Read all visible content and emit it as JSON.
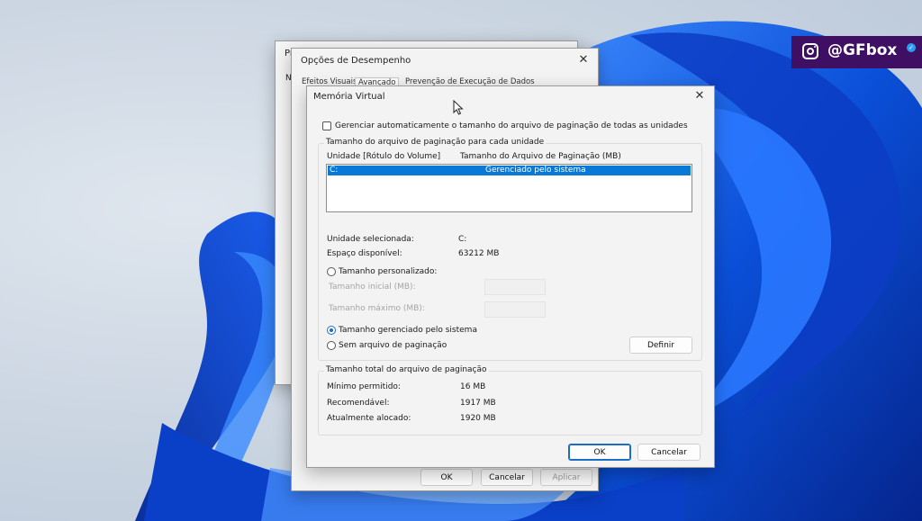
{
  "watermark": {
    "handle": "@GFbox",
    "icon": "instagram-icon",
    "verified_icon": "verified-check-icon"
  },
  "back_window": {
    "title": "Pr",
    "tab_letter": "N"
  },
  "perf_window": {
    "title": "Opções de Desempenho",
    "tabs": [
      "Efeitos Visuais",
      "Avançado",
      "Prevenção de Execução de Dados"
    ],
    "buttons": {
      "ok": "OK",
      "cancel": "Cancelar",
      "apply": "Aplicar"
    }
  },
  "vm_dialog": {
    "title": "Memória Virtual",
    "auto_manage_label": "Gerenciar automaticamente o tamanho do arquivo de paginação de todas as unidades",
    "auto_manage_checked": false,
    "per_drive_group": {
      "label": "Tamanho do arquivo de paginação para cada unidade",
      "col_drive": "Unidade [Rótulo do Volume]",
      "col_size": "Tamanho do Arquivo de Paginação (MB)",
      "rows": [
        {
          "drive": "C:",
          "size": "Gerenciado pelo sistema"
        }
      ],
      "selected_drive_label": "Unidade selecionada:",
      "selected_drive_value": "C:",
      "free_space_label": "Espaço disponível:",
      "free_space_value": "63212 MB",
      "custom_size_label": "Tamanho personalizado:",
      "initial_size_label": "Tamanho inicial (MB):",
      "max_size_label": "Tamanho máximo (MB):",
      "system_managed_label": "Tamanho gerenciado pelo sistema",
      "no_paging_label": "Sem arquivo de paginação",
      "selected_option": "system_managed",
      "set_button": "Definir"
    },
    "total_group": {
      "label": "Tamanho total do arquivo de paginação",
      "min_label": "Mínimo permitido:",
      "min_value": "16 MB",
      "recommended_label": "Recomendável:",
      "recommended_value": "1917 MB",
      "allocated_label": "Atualmente alocado:",
      "allocated_value": "1920 MB"
    },
    "buttons": {
      "ok": "OK",
      "cancel": "Cancelar"
    }
  }
}
